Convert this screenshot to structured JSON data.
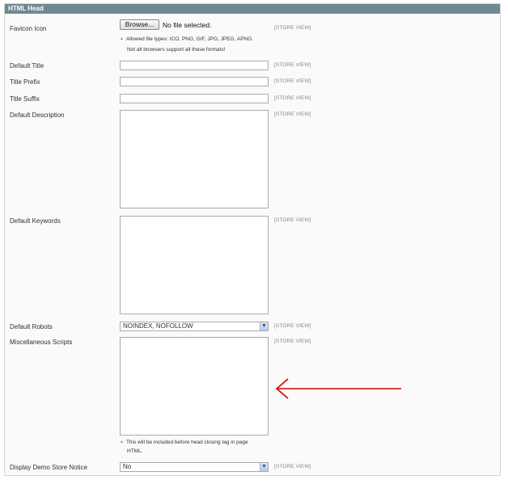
{
  "section": {
    "title": "HTML Head"
  },
  "scope_label": "[STORE VIEW]",
  "favicon": {
    "label": "Favicon Icon",
    "browse_label": "Browse...",
    "file_status": "No file selected.",
    "note_line1": "Allowed file types: ICO, PNG, GIF, JPG, JPEG, APNG.",
    "note_line2": "Not all browsers support all these formats!"
  },
  "fields": {
    "default_title": {
      "label": "Default Title",
      "value": ""
    },
    "title_prefix": {
      "label": "Title Prefix",
      "value": ""
    },
    "title_suffix": {
      "label": "Title Suffix",
      "value": ""
    },
    "default_description": {
      "label": "Default Description",
      "value": ""
    },
    "default_keywords": {
      "label": "Default Keywords",
      "value": ""
    },
    "default_robots": {
      "label": "Default Robots",
      "value": "NOINDEX, NOFOLLOW"
    },
    "misc_scripts": {
      "label": "Miscellaneous Scripts",
      "value": "",
      "note_line1": "This will be included before head closing tag in page",
      "note_line2": "HTML."
    },
    "demo_notice": {
      "label": "Display Demo Store Notice",
      "value": "No"
    }
  },
  "colors": {
    "header": "#6f8992",
    "arrow": "#cc0000"
  }
}
